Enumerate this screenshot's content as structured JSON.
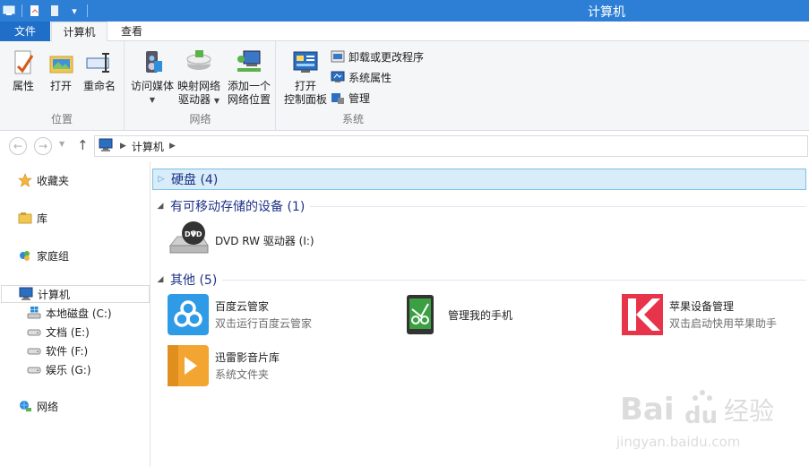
{
  "window": {
    "title": "计算机"
  },
  "ribbon_tabs": [
    {
      "label": "文件"
    },
    {
      "label": "计算机"
    },
    {
      "label": "查看"
    }
  ],
  "ribbon": {
    "location_group": {
      "label": "位置",
      "buttons": [
        {
          "label": "属性",
          "icon": "properties-icon"
        },
        {
          "label": "打开",
          "icon": "open-icon"
        },
        {
          "label": "重命名",
          "icon": "rename-icon"
        }
      ]
    },
    "network_group": {
      "label": "网络",
      "buttons": [
        {
          "label": "访问媒体",
          "icon": "media-icon"
        },
        {
          "line1": "映射网络",
          "line2": "驱动器",
          "icon": "map-drive-icon"
        },
        {
          "line1": "添加一个",
          "line2": "网络位置",
          "icon": "add-network-location-icon"
        }
      ]
    },
    "system_group": {
      "label": "系统",
      "open_control_panel": {
        "line1": "打开",
        "line2": "控制面板",
        "icon": "control-panel-icon"
      },
      "small_buttons": [
        {
          "label": "卸载或更改程序",
          "icon": "uninstall-icon"
        },
        {
          "label": "系统属性",
          "icon": "system-properties-icon"
        },
        {
          "label": "管理",
          "icon": "manage-icon"
        }
      ]
    }
  },
  "address": {
    "crumbs": [
      "计算机"
    ]
  },
  "nav_pane": {
    "favorites": "收藏夹",
    "libraries": "库",
    "homegroup": "家庭组",
    "computer": "计算机",
    "drives": [
      {
        "label": "本地磁盘 (C:)"
      },
      {
        "label": "文档 (E:)"
      },
      {
        "label": "软件 (F:)"
      },
      {
        "label": "娱乐 (G:)"
      }
    ],
    "network": "网络"
  },
  "content": {
    "groups": {
      "hard_disks": "硬盘 (4)",
      "removable": "有可移动存储的设备 (1)",
      "other": "其他 (5)"
    },
    "dvd": {
      "name": "DVD RW 驱动器 (I:)",
      "badge": "DVD"
    },
    "others": [
      {
        "name": "百度云管家",
        "desc": "双击运行百度云管家"
      },
      {
        "name": "管理我的手机",
        "desc": ""
      },
      {
        "name": "苹果设备管理",
        "desc": "双击启动快用苹果助手"
      },
      {
        "name": "迅雷影音片库",
        "desc": "系统文件夹"
      }
    ]
  },
  "watermark": {
    "brand": "Bai",
    "brand2": "du",
    "brand3": "经验",
    "url": "jingyan.baidu.com"
  },
  "colors": {
    "titlebar": "#2d7fd6",
    "file_tab": "#1f6ec8",
    "group_header": "#1e3287"
  }
}
